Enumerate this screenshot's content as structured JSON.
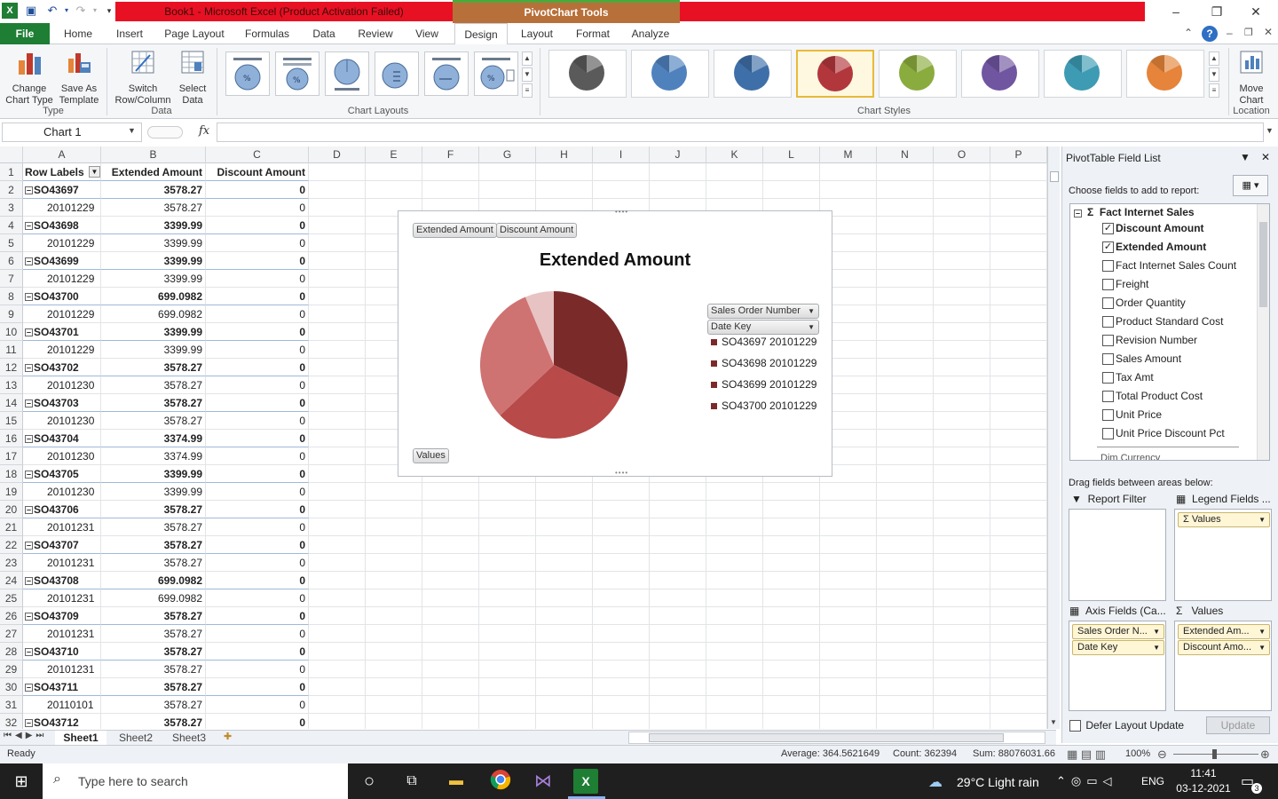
{
  "window": {
    "title": "Book1 - Microsoft Excel (Product Activation Failed)",
    "context_tools": "PivotChart Tools",
    "controls": [
      "–",
      "❐",
      "✕"
    ]
  },
  "tabs": [
    "File",
    "Home",
    "Insert",
    "Page Layout",
    "Formulas",
    "Data",
    "Review",
    "View",
    "Design",
    "Layout",
    "Format",
    "Analyze"
  ],
  "active_tab": "Design",
  "ribbon": {
    "type_group": {
      "label": "Type",
      "change_chart_type": [
        "Change",
        "Chart Type"
      ],
      "save_as_template": [
        "Save As",
        "Template"
      ]
    },
    "data_group": {
      "label": "Data",
      "switch": [
        "Switch",
        "Row/Column"
      ],
      "select": [
        "Select",
        "Data"
      ]
    },
    "layouts_group": {
      "label": "Chart Layouts"
    },
    "styles_group": {
      "label": "Chart Styles",
      "colors": [
        "#5a5a5a",
        "#4f81bd",
        "#3f6fa8",
        "#b2373c",
        "#8aab3e",
        "#7055a0",
        "#3d9bb3",
        "#e5843a"
      ],
      "selected_index": 3
    },
    "location_group": {
      "label": "Location",
      "move_chart": [
        "Move",
        "Chart"
      ]
    }
  },
  "formula_bar": {
    "name_box": "Chart 1",
    "fx": "fx",
    "value": ""
  },
  "columns": [
    "A",
    "B",
    "C",
    "D",
    "E",
    "F",
    "G",
    "H",
    "I",
    "J",
    "K",
    "L",
    "M",
    "N",
    "O",
    "P"
  ],
  "pivot_header": {
    "a": "Row Labels",
    "b": "Extended Amount",
    "c": "Discount Amount"
  },
  "rows": [
    {
      "label": "SO43697",
      "b": "3578.27",
      "c": "0",
      "group": true
    },
    {
      "label": "20101229",
      "b": "3578.27",
      "c": "0",
      "group": false
    },
    {
      "label": "SO43698",
      "b": "3399.99",
      "c": "0",
      "group": true
    },
    {
      "label": "20101229",
      "b": "3399.99",
      "c": "0",
      "group": false
    },
    {
      "label": "SO43699",
      "b": "3399.99",
      "c": "0",
      "group": true
    },
    {
      "label": "20101229",
      "b": "3399.99",
      "c": "0",
      "group": false
    },
    {
      "label": "SO43700",
      "b": "699.0982",
      "c": "0",
      "group": true
    },
    {
      "label": "20101229",
      "b": "699.0982",
      "c": "0",
      "group": false
    },
    {
      "label": "SO43701",
      "b": "3399.99",
      "c": "0",
      "group": true
    },
    {
      "label": "20101229",
      "b": "3399.99",
      "c": "0",
      "group": false
    },
    {
      "label": "SO43702",
      "b": "3578.27",
      "c": "0",
      "group": true
    },
    {
      "label": "20101230",
      "b": "3578.27",
      "c": "0",
      "group": false
    },
    {
      "label": "SO43703",
      "b": "3578.27",
      "c": "0",
      "group": true
    },
    {
      "label": "20101230",
      "b": "3578.27",
      "c": "0",
      "group": false
    },
    {
      "label": "SO43704",
      "b": "3374.99",
      "c": "0",
      "group": true
    },
    {
      "label": "20101230",
      "b": "3374.99",
      "c": "0",
      "group": false
    },
    {
      "label": "SO43705",
      "b": "3399.99",
      "c": "0",
      "group": true
    },
    {
      "label": "20101230",
      "b": "3399.99",
      "c": "0",
      "group": false
    },
    {
      "label": "SO43706",
      "b": "3578.27",
      "c": "0",
      "group": true
    },
    {
      "label": "20101231",
      "b": "3578.27",
      "c": "0",
      "group": false
    },
    {
      "label": "SO43707",
      "b": "3578.27",
      "c": "0",
      "group": true
    },
    {
      "label": "20101231",
      "b": "3578.27",
      "c": "0",
      "group": false
    },
    {
      "label": "SO43708",
      "b": "699.0982",
      "c": "0",
      "group": true
    },
    {
      "label": "20101231",
      "b": "699.0982",
      "c": "0",
      "group": false
    },
    {
      "label": "SO43709",
      "b": "3578.27",
      "c": "0",
      "group": true
    },
    {
      "label": "20101231",
      "b": "3578.27",
      "c": "0",
      "group": false
    },
    {
      "label": "SO43710",
      "b": "3578.27",
      "c": "0",
      "group": true
    },
    {
      "label": "20101231",
      "b": "3578.27",
      "c": "0",
      "group": false
    },
    {
      "label": "SO43711",
      "b": "3578.27",
      "c": "0",
      "group": true
    },
    {
      "label": "20110101",
      "b": "3578.27",
      "c": "0",
      "group": false
    },
    {
      "label": "SO43712",
      "b": "3578.27",
      "c": "0",
      "group": true
    }
  ],
  "chart": {
    "field_buttons": [
      "Extended Amount",
      "Discount Amount"
    ],
    "axis_buttons": [
      "Sales Order Number",
      "Date Key"
    ],
    "values_button": "Values"
  },
  "chart_data": {
    "type": "pie",
    "title": "Extended Amount",
    "categories": [
      "SO43697 20101229",
      "SO43698 20101229",
      "SO43699 20101229",
      "SO43700 20101229"
    ],
    "values": [
      3578.27,
      3399.99,
      3399.99,
      699.0982
    ],
    "colors": [
      "#7b2a2a",
      "#b84a4a",
      "#cf7272",
      "#e8c3c3"
    ]
  },
  "field_list": {
    "title": "PivotTable Field List",
    "choose_label": "Choose fields to add to report:",
    "table_name": "Fact Internet Sales",
    "fields": [
      {
        "name": "Discount Amount",
        "checked": true
      },
      {
        "name": "Extended Amount",
        "checked": true
      },
      {
        "name": "Fact Internet Sales Count",
        "checked": false
      },
      {
        "name": "Freight",
        "checked": false
      },
      {
        "name": "Order Quantity",
        "checked": false
      },
      {
        "name": "Product Standard Cost",
        "checked": false
      },
      {
        "name": "Revision Number",
        "checked": false
      },
      {
        "name": "Sales Amount",
        "checked": false
      },
      {
        "name": "Tax Amt",
        "checked": false
      },
      {
        "name": "Total Product Cost",
        "checked": false
      },
      {
        "name": "Unit Price",
        "checked": false
      },
      {
        "name": "Unit Price Discount Pct",
        "checked": false
      }
    ],
    "next_table": "Dim Currency",
    "drag_label": "Drag fields between areas below:",
    "report_filter": "Report Filter",
    "legend_fields": "Legend Fields ...",
    "legend_items": [
      "Values"
    ],
    "axis_fields": "Axis Fields (Ca...",
    "axis_items": [
      "Sales Order N...",
      "Date Key"
    ],
    "values_label": "Values",
    "values_items": [
      "Extended Am...",
      "Discount Amo..."
    ],
    "defer": "Defer Layout Update",
    "update": "Update"
  },
  "sheets": [
    "Sheet1",
    "Sheet2",
    "Sheet3"
  ],
  "status": {
    "ready": "Ready",
    "average": "Average: 364.5621649",
    "count": "Count: 362394",
    "sum": "Sum: 88076031.66",
    "zoom": "100%"
  },
  "taskbar": {
    "search": "Type here to search",
    "weather": "29°C  Light rain",
    "lang": "ENG",
    "time": "11:41",
    "date": "03-12-2021",
    "notifications": "3"
  }
}
